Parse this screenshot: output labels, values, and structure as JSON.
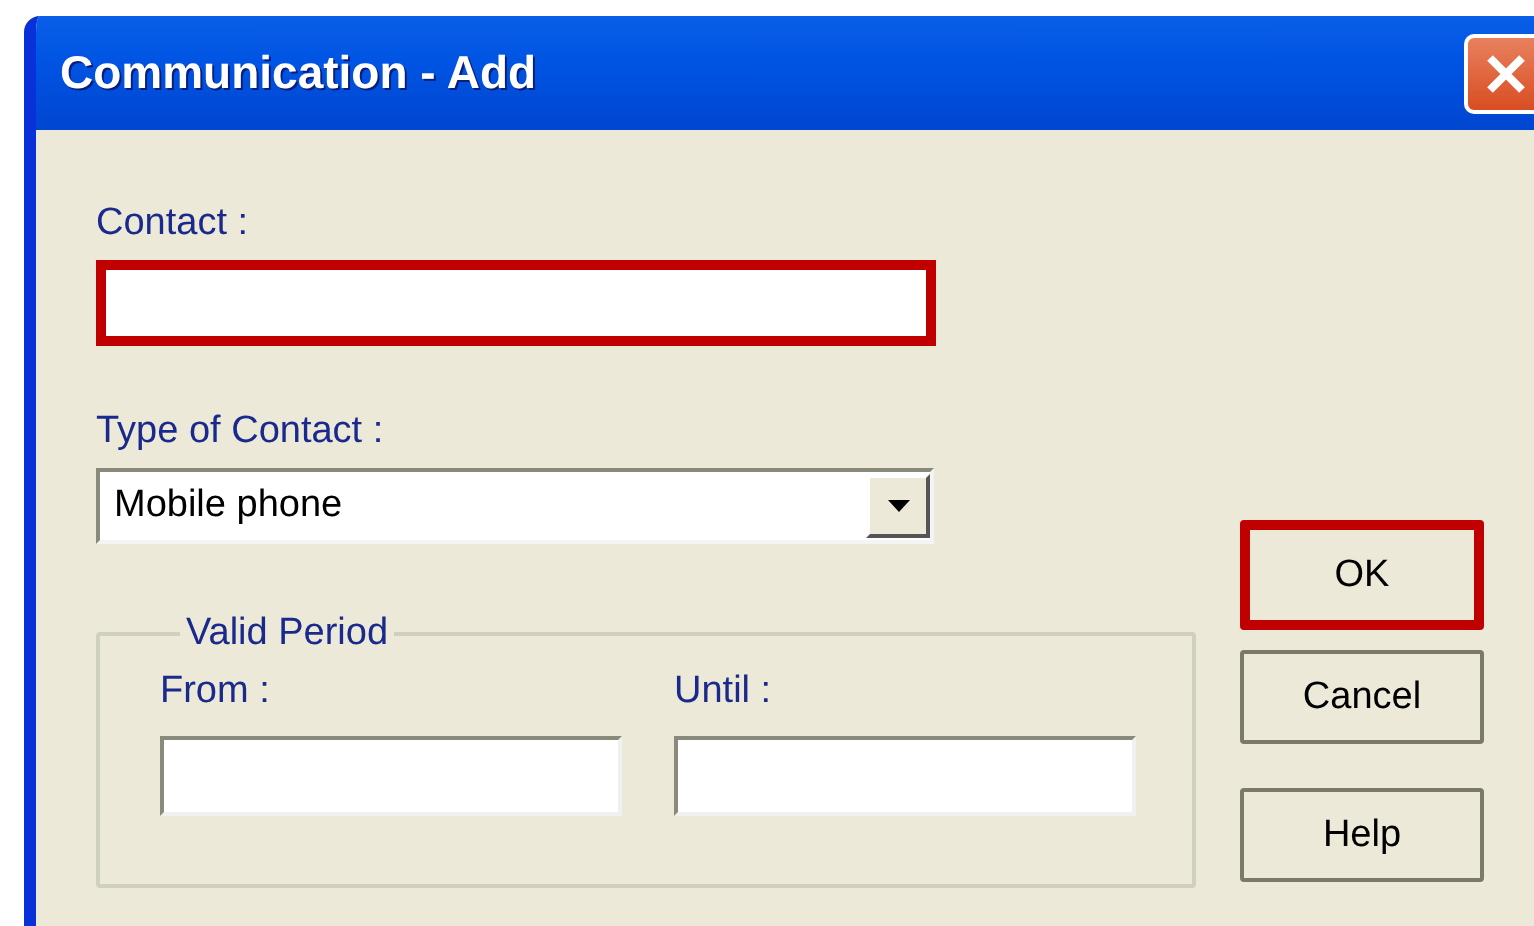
{
  "window": {
    "title": "Communication - Add"
  },
  "contact": {
    "label": "Contact :",
    "highlighted": true
  },
  "type_of_contact": {
    "label": "Type of Contact :",
    "value": "Mobile phone"
  },
  "valid_period": {
    "legend": "Valid Period",
    "fields": [
      {
        "label": "From :",
        "highlighted": false
      },
      {
        "label": "Until :",
        "highlighted": false
      }
    ]
  },
  "buttons": [
    {
      "label": "OK",
      "highlighted": true
    },
    {
      "label": "Cancel",
      "highlighted": false
    },
    {
      "label": "Help",
      "highlighted": false
    }
  ]
}
